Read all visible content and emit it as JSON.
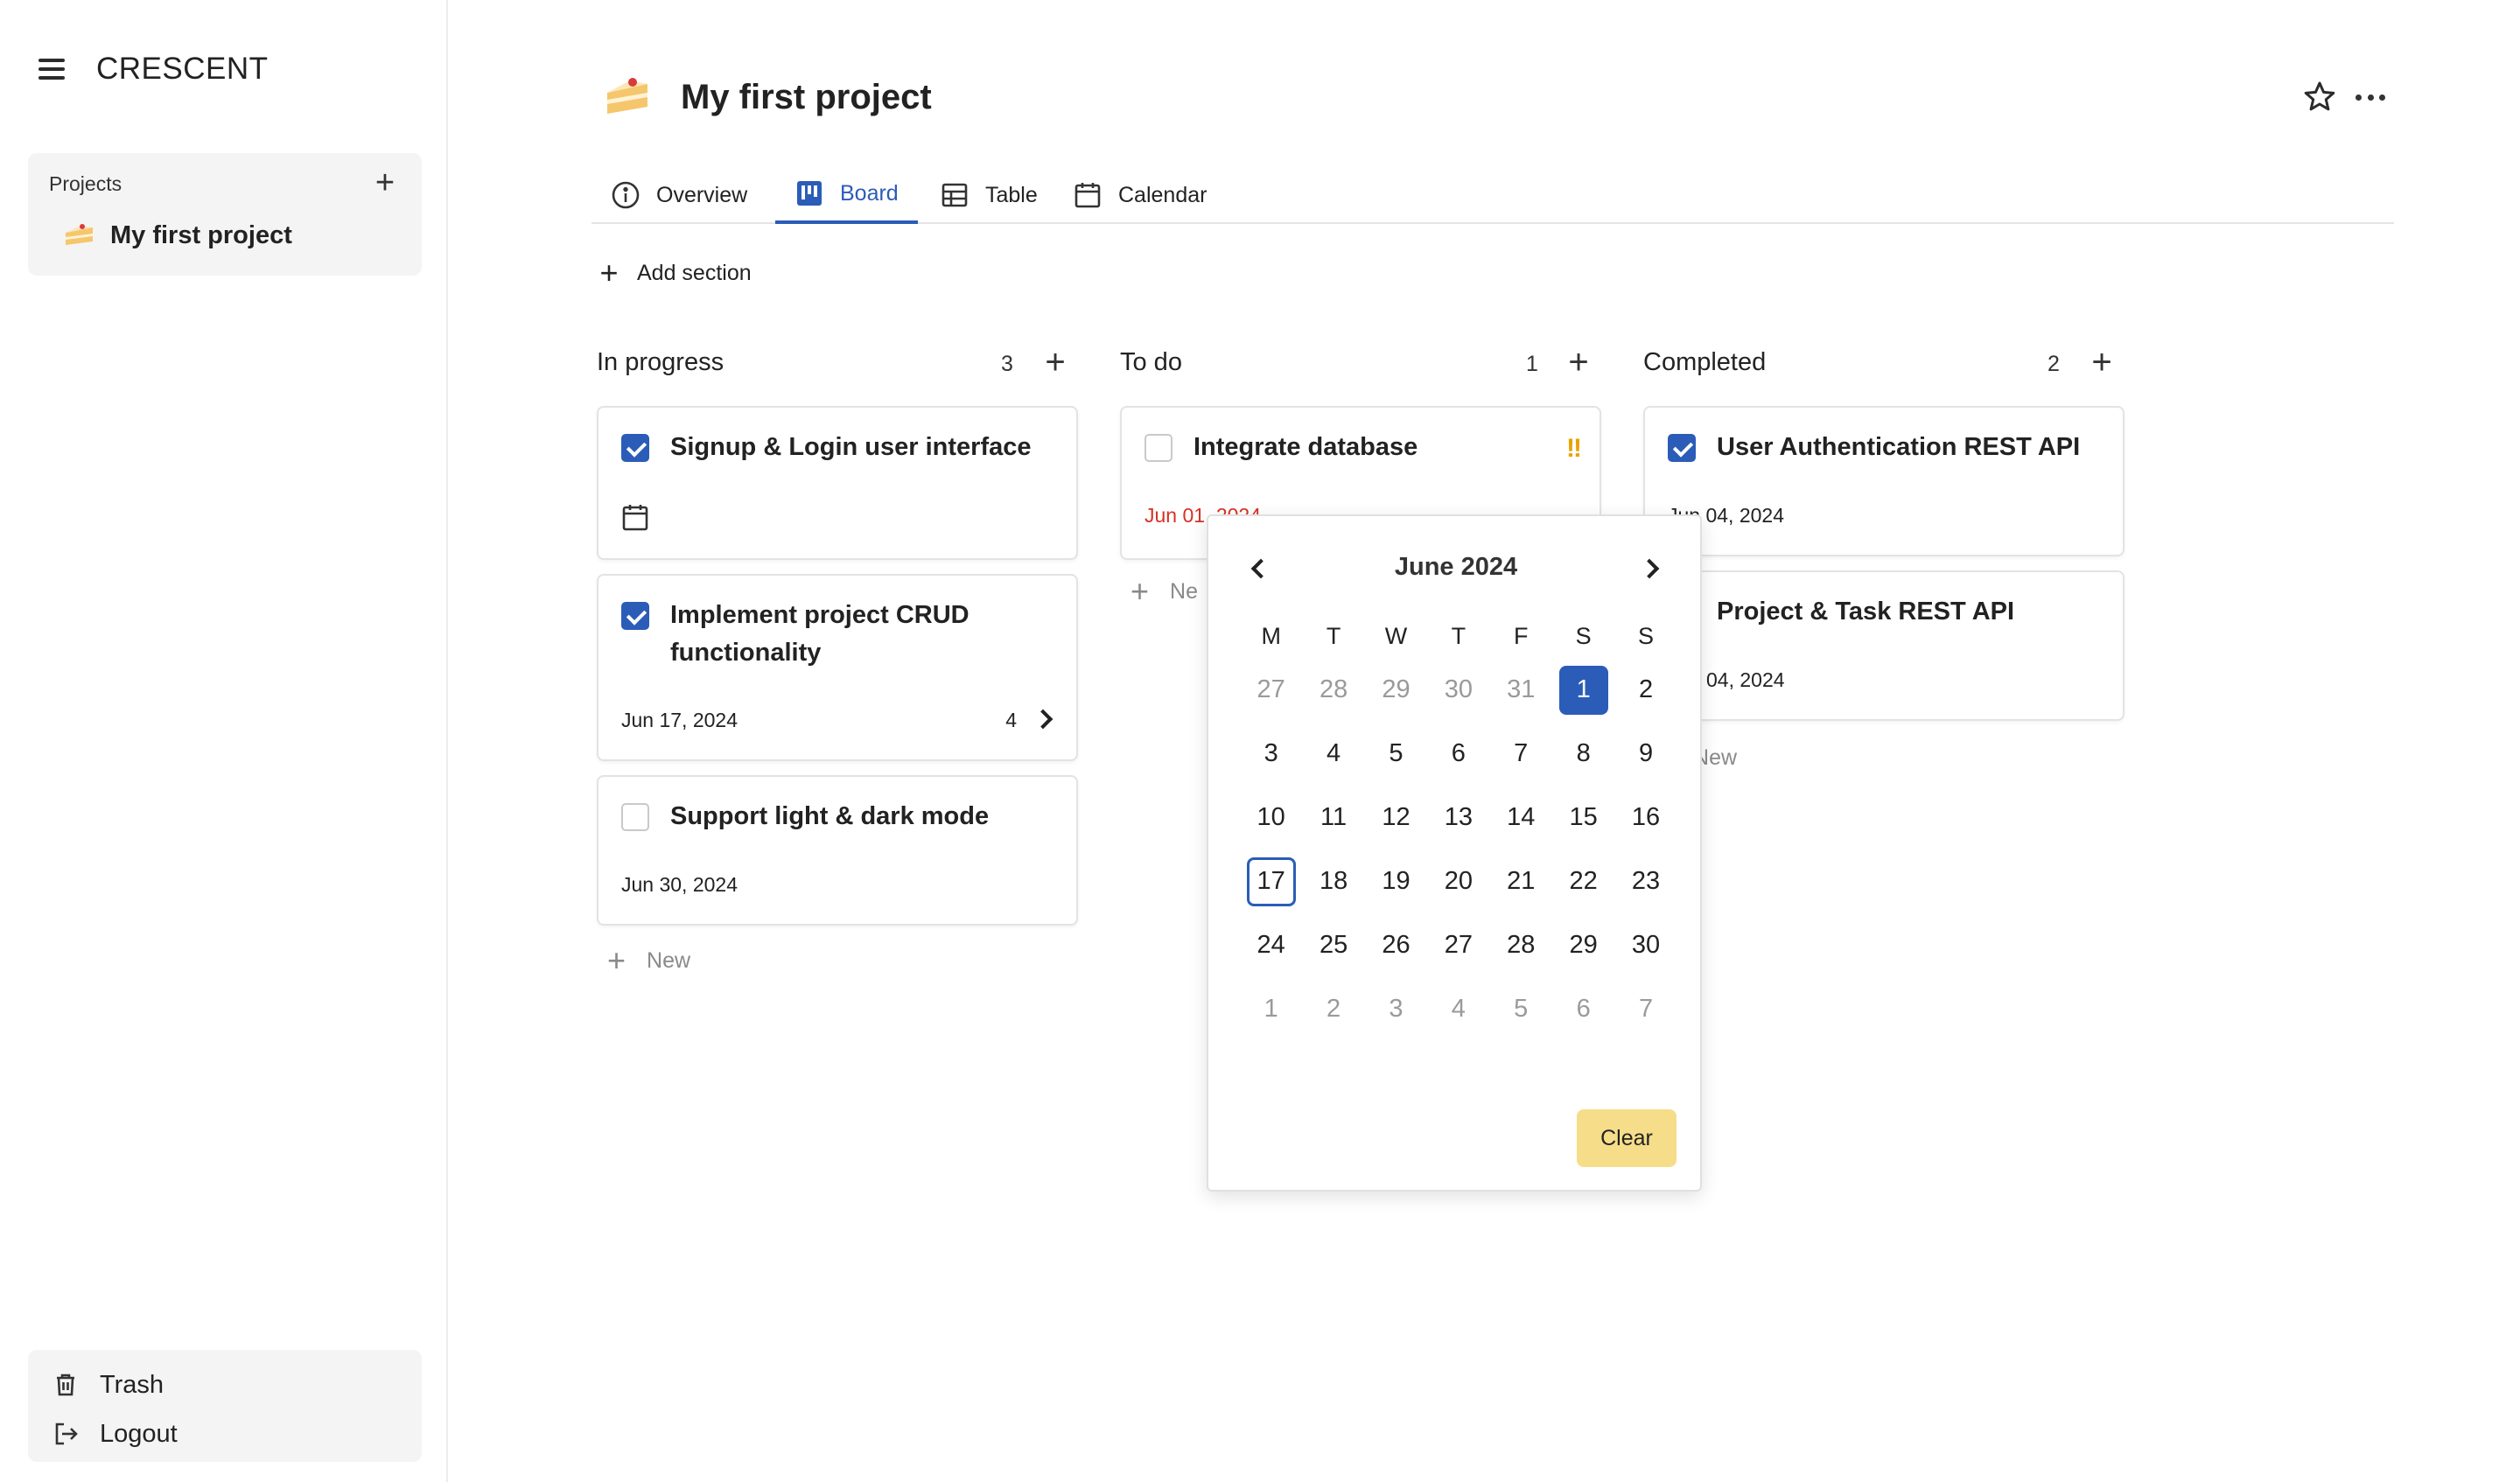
{
  "app": {
    "brand": "CRESCENT"
  },
  "sidebar": {
    "projects_label": "Projects",
    "projects": [
      {
        "name": "My first project",
        "icon": "cake-icon"
      }
    ],
    "bottom": [
      {
        "label": "Trash",
        "icon": "trash-icon"
      },
      {
        "label": "Logout",
        "icon": "logout-icon"
      }
    ]
  },
  "header": {
    "title": "My first project",
    "icon": "cake-icon"
  },
  "tabs": [
    {
      "label": "Overview",
      "icon": "info-icon",
      "active": false
    },
    {
      "label": "Board",
      "icon": "board-icon",
      "active": true
    },
    {
      "label": "Table",
      "icon": "table-icon",
      "active": false
    },
    {
      "label": "Calendar",
      "icon": "calendar-icon",
      "active": false
    }
  ],
  "toolbar": {
    "add_section": "Add section"
  },
  "columns": [
    {
      "title": "In progress",
      "count": "3",
      "new_label": "New",
      "tasks": [
        {
          "title": "Signup & Login user interface",
          "checked": true,
          "date": "",
          "show_calendar_icon": true
        },
        {
          "title": "Implement project CRUD functionality",
          "checked": true,
          "date": "Jun 17, 2024",
          "subtasks": "4"
        },
        {
          "title": "Support light & dark mode",
          "checked": false,
          "date": "Jun 30, 2024"
        }
      ]
    },
    {
      "title": "To do",
      "count": "1",
      "new_label": "Ne",
      "tasks": [
        {
          "title": "Integrate database",
          "checked": false,
          "date": "Jun 01, 2024",
          "overdue": true,
          "priority": "!!"
        }
      ]
    },
    {
      "title": "Completed",
      "count": "2",
      "new_label": "New",
      "tasks": [
        {
          "title": "User Authentication REST API",
          "checked": true,
          "date": "Jun 04, 2024"
        },
        {
          "title": "Project & Task REST API",
          "checked": true,
          "date": "04, 2024"
        }
      ]
    }
  ],
  "datepicker": {
    "month_label": "June 2024",
    "weekdays": [
      "M",
      "T",
      "W",
      "T",
      "F",
      "S",
      "S"
    ],
    "days": [
      {
        "d": "27",
        "m": true
      },
      {
        "d": "28",
        "m": true
      },
      {
        "d": "29",
        "m": true
      },
      {
        "d": "30",
        "m": true
      },
      {
        "d": "31",
        "m": true
      },
      {
        "d": "1",
        "sel": true
      },
      {
        "d": "2"
      },
      {
        "d": "3"
      },
      {
        "d": "4"
      },
      {
        "d": "5"
      },
      {
        "d": "6"
      },
      {
        "d": "7"
      },
      {
        "d": "8"
      },
      {
        "d": "9"
      },
      {
        "d": "10"
      },
      {
        "d": "11"
      },
      {
        "d": "12"
      },
      {
        "d": "13"
      },
      {
        "d": "14"
      },
      {
        "d": "15"
      },
      {
        "d": "16"
      },
      {
        "d": "17",
        "today": true
      },
      {
        "d": "18"
      },
      {
        "d": "19"
      },
      {
        "d": "20"
      },
      {
        "d": "21"
      },
      {
        "d": "22"
      },
      {
        "d": "23"
      },
      {
        "d": "24"
      },
      {
        "d": "25"
      },
      {
        "d": "26"
      },
      {
        "d": "27"
      },
      {
        "d": "28"
      },
      {
        "d": "29"
      },
      {
        "d": "30"
      },
      {
        "d": "1",
        "m": true
      },
      {
        "d": "2",
        "m": true
      },
      {
        "d": "3",
        "m": true
      },
      {
        "d": "4",
        "m": true
      },
      {
        "d": "5",
        "m": true
      },
      {
        "d": "6",
        "m": true
      },
      {
        "d": "7",
        "m": true
      }
    ],
    "clear_label": "Clear"
  },
  "colors": {
    "accent": "#2b5cb8",
    "overdue": "#d93025",
    "priority": "#e8a200",
    "clear_button": "#f6dd8a"
  }
}
